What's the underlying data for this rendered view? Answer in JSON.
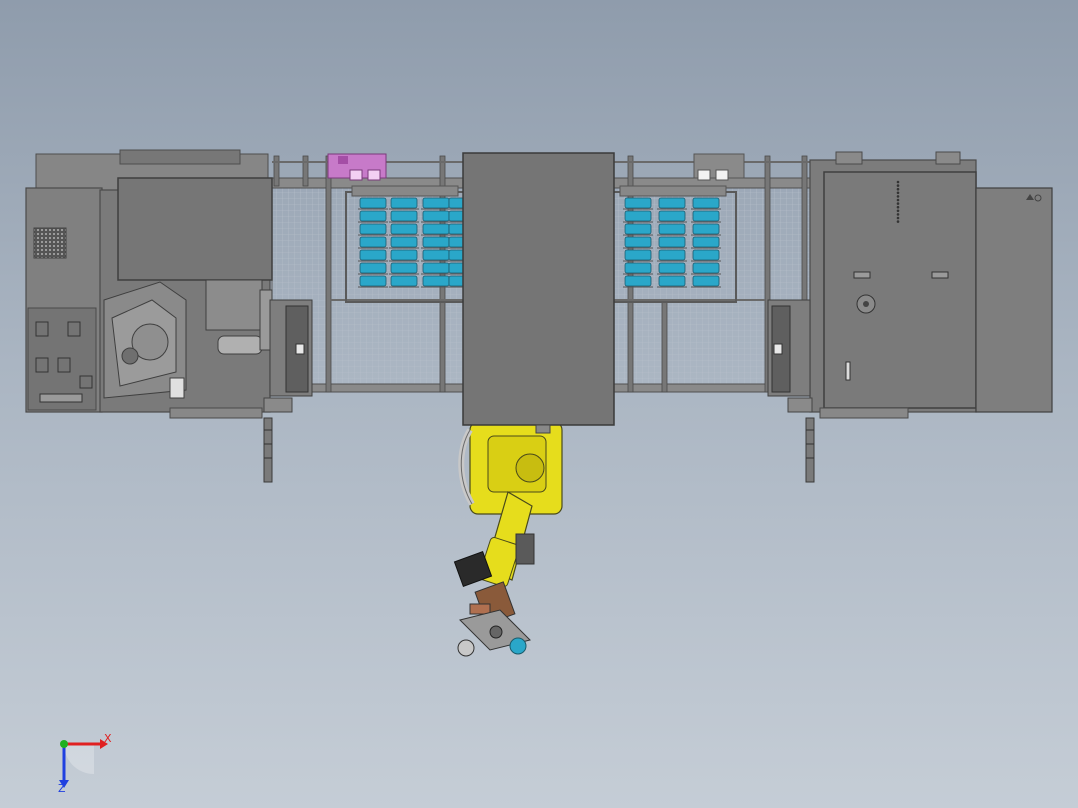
{
  "viewport": {
    "background_top": "#8f9cac",
    "background_bottom": "#c5cdd6"
  },
  "model": {
    "frame_color": "#6b6b6b",
    "panel_fill": "#7d7d7d",
    "cover_fill": "#757575",
    "robot_color": "#e6dd1c",
    "spool_color": "#2aa7c9",
    "accent_magenta": "#c77ac9",
    "components": [
      "left-machine",
      "left-lathe",
      "fence-mesh",
      "spool-racks",
      "center-cover",
      "right-machine",
      "robot-arm",
      "gripper"
    ]
  },
  "triad": {
    "x_label": "X",
    "z_label": "Z",
    "x_color": "#e02020",
    "y_color": "#20b020",
    "z_color": "#2040e0"
  }
}
